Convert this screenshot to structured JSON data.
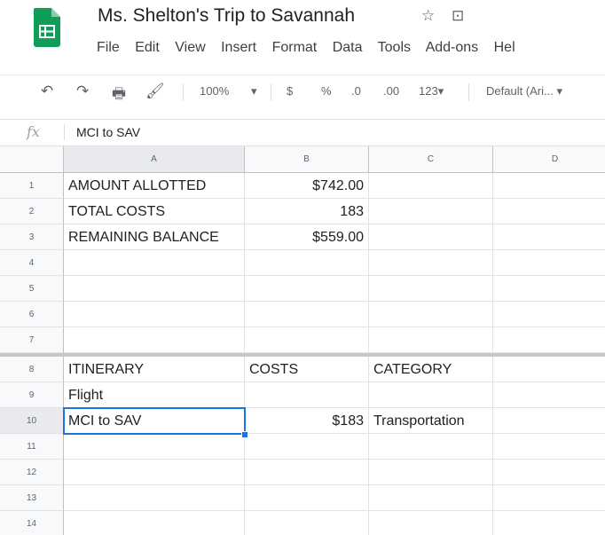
{
  "header": {
    "title": "Ms. Shelton's Trip to Savannah",
    "star_icon": "☆",
    "move_icon": "⊡",
    "menu": [
      "File",
      "Edit",
      "View",
      "Insert",
      "Format",
      "Data",
      "Tools",
      "Add-ons",
      "Hel"
    ]
  },
  "toolbar": {
    "undo": "↶",
    "redo": "↷",
    "print": "🖶",
    "paint": "🖌",
    "zoom": "100%",
    "dropdown": "▾",
    "currency": "$",
    "percent": "%",
    "dec_decrease": ".0",
    "dec_increase": ".00",
    "more_formats": "123▾",
    "font": "Default (Ari...  ▾"
  },
  "formula_bar": {
    "fx": "fx",
    "value": "MCI to SAV"
  },
  "columns": [
    "A",
    "B",
    "C",
    "D"
  ],
  "rows": [
    "1",
    "2",
    "3",
    "4",
    "5",
    "6",
    "7",
    "8",
    "9",
    "10",
    "11",
    "12",
    "13",
    "14"
  ],
  "cells": {
    "a1": "AMOUNT ALLOTTED",
    "b1": "$742.00",
    "a2": "TOTAL COSTS",
    "b2": "183",
    "a3": "REMAINING BALANCE",
    "b3": "$559.00",
    "a8": "ITINERARY",
    "b8": "COSTS",
    "c8": "CATEGORY",
    "a9": "Flight",
    "a10": "MCI to SAV",
    "b10": "$183",
    "c10": "Transportation"
  },
  "colors": {
    "accent": "#1a73e8",
    "sheets_green": "#0f9d58"
  }
}
